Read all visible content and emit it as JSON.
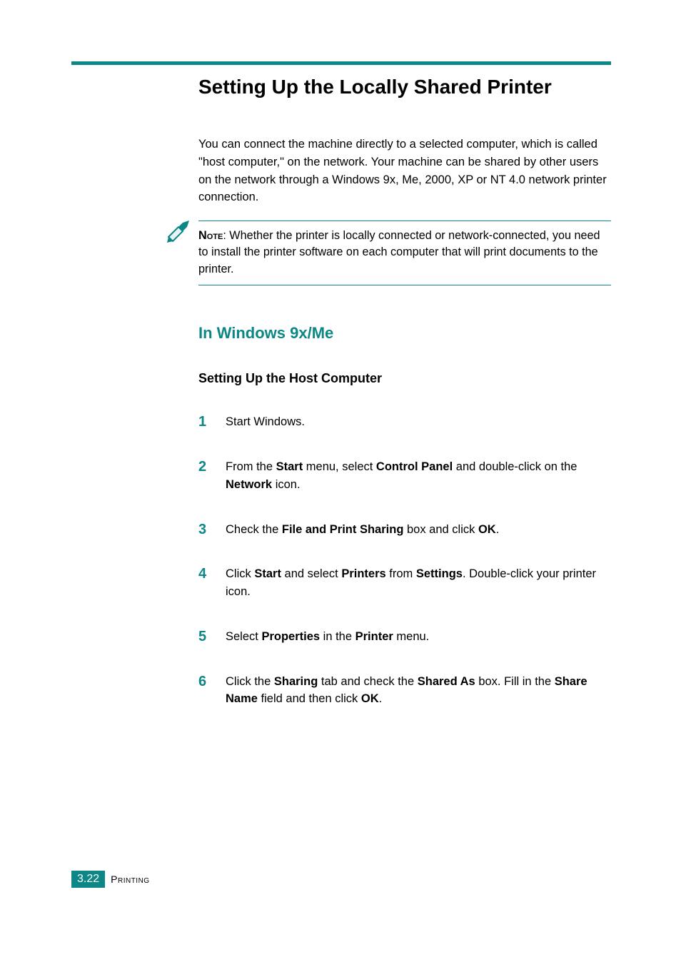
{
  "heading": "Setting Up the Locally Shared Printer",
  "intro": "You can connect the machine directly to a selected computer, which is called \"host computer,\" on the network. Your machine can be shared by other users on the network through a Windows 9x, Me, 2000, XP or NT 4.0 network printer connection.",
  "note": {
    "label": "Note",
    "body": ": Whether the printer is locally connected or network-connected, you need to install the printer software on each computer that will print documents to the printer."
  },
  "section_heading": "In Windows 9x/Me",
  "subsection_heading": "Setting Up the Host Computer",
  "steps": [
    {
      "num": "1",
      "parts": [
        {
          "t": "Start Windows."
        }
      ]
    },
    {
      "num": "2",
      "parts": [
        {
          "t": "From the "
        },
        {
          "t": "Start",
          "b": true
        },
        {
          "t": " menu, select "
        },
        {
          "t": "Control Panel",
          "b": true
        },
        {
          "t": " and double-click on the "
        },
        {
          "t": "Network",
          "b": true
        },
        {
          "t": " icon."
        }
      ]
    },
    {
      "num": "3",
      "parts": [
        {
          "t": "Check the "
        },
        {
          "t": "File and Print Sharing",
          "b": true
        },
        {
          "t": " box and click "
        },
        {
          "t": "OK",
          "b": true
        },
        {
          "t": "."
        }
      ]
    },
    {
      "num": "4",
      "parts": [
        {
          "t": "Click "
        },
        {
          "t": "Start",
          "b": true
        },
        {
          "t": " and select "
        },
        {
          "t": "Printers",
          "b": true
        },
        {
          "t": " from "
        },
        {
          "t": "Settings",
          "b": true
        },
        {
          "t": ". Double-click your printer icon."
        }
      ]
    },
    {
      "num": "5",
      "parts": [
        {
          "t": "Select "
        },
        {
          "t": "Properties",
          "b": true
        },
        {
          "t": " in the "
        },
        {
          "t": "Printer",
          "b": true
        },
        {
          "t": " menu."
        }
      ]
    },
    {
      "num": "6",
      "parts": [
        {
          "t": "Click the "
        },
        {
          "t": "Sharing",
          "b": true
        },
        {
          "t": " tab and check the "
        },
        {
          "t": "Shared As",
          "b": true
        },
        {
          "t": " box. Fill in the "
        },
        {
          "t": "Share Name",
          "b": true
        },
        {
          "t": " field and then click "
        },
        {
          "t": "OK",
          "b": true
        },
        {
          "t": "."
        }
      ]
    }
  ],
  "footer": {
    "page": "3.22",
    "label": "Printing"
  },
  "colors": {
    "accent": "#0d8686"
  }
}
